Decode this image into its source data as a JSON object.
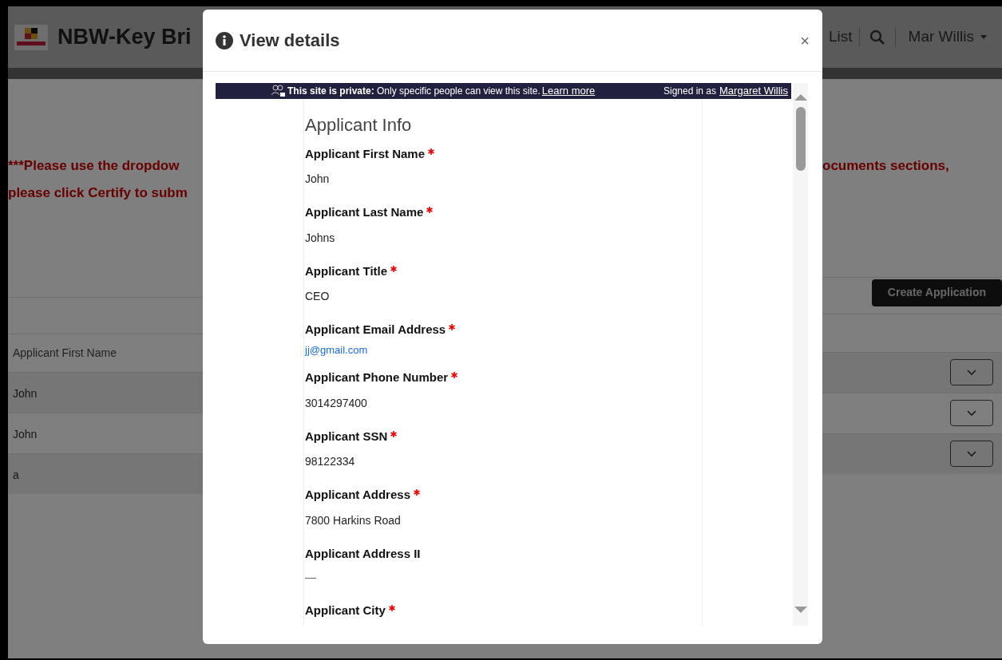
{
  "page": {
    "app_title": "NBW-Key Bri",
    "nav_link": "List",
    "user_menu": "Mar Willis",
    "notice_left": [
      "***Please use the dropdow",
      "please click Certify to subm"
    ],
    "notice_right": "ocuments sections,",
    "create_button": "Create Application",
    "table": {
      "columns": [
        "Applicant First Name"
      ],
      "rows": [
        {
          "cells": [
            "John"
          ]
        },
        {
          "cells": [
            "John"
          ]
        },
        {
          "cells": [
            "a"
          ]
        }
      ]
    }
  },
  "dialog": {
    "title": "View details",
    "close": "×",
    "banner": {
      "private_label": "This site is private:",
      "private_text": "Only specific people can view this site.",
      "learn_more": "Learn more",
      "signed_in": "Signed in as",
      "user": "Margaret Willis"
    },
    "section_title": "Applicant Info",
    "fields": [
      {
        "label": "Applicant First Name",
        "required": true,
        "kind": "text",
        "value": "John"
      },
      {
        "label": "Applicant Last Name",
        "required": true,
        "kind": "text",
        "value": "Johns"
      },
      {
        "label": "Applicant Title",
        "required": true,
        "kind": "text",
        "value": "CEO"
      },
      {
        "label": "Applicant Email Address",
        "required": true,
        "kind": "link",
        "value": "jj@gmail.com"
      },
      {
        "label": "Applicant Phone Number",
        "required": true,
        "kind": "text",
        "value": "3014297400"
      },
      {
        "label": "Applicant SSN",
        "required": true,
        "kind": "text",
        "value": "98122334"
      },
      {
        "label": "Applicant Address",
        "required": true,
        "kind": "text",
        "value": "7800 Harkins Road"
      },
      {
        "label": "Applicant Address II",
        "required": false,
        "kind": "empty",
        "value": "—"
      },
      {
        "label": "Applicant City",
        "required": true,
        "kind": "cut"
      }
    ]
  }
}
